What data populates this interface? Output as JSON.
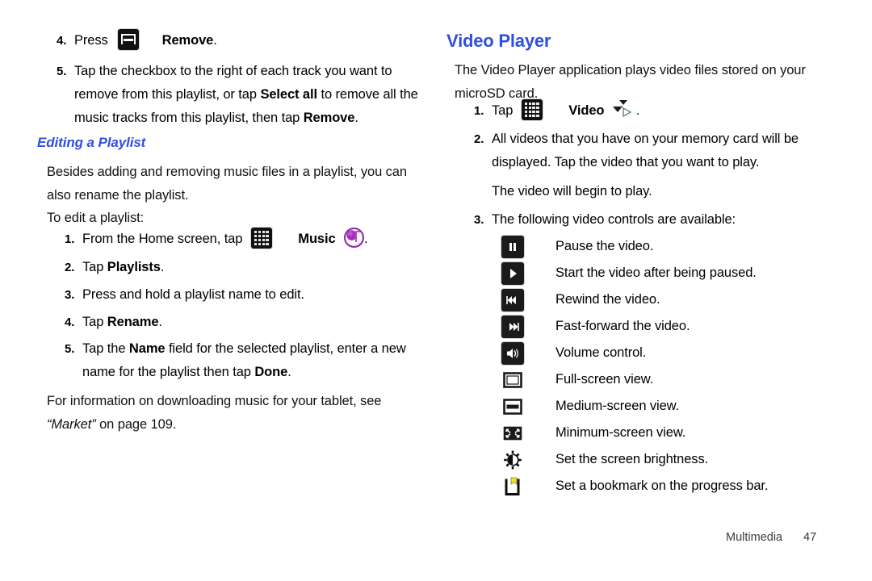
{
  "document": {
    "footer": {
      "section": "Multimedia",
      "page_number": "47"
    },
    "heading_color": "#2f4fe0",
    "body_color": "#111111"
  },
  "left_column": {
    "steps_continued": [
      {
        "num": "4.",
        "pre": "Press",
        "icon": "menu-key-icon",
        "bold_after": "Remove",
        "post": "."
      }
    ],
    "step5": {
      "num": "5.",
      "line1_a": "Tap the checkbox to the right of each track you want to",
      "line2_a": "remove from this playlist, or tap ",
      "line2_b": "Select all",
      "line2_c": " to remove all the",
      "line3_a": "music tracks from this playlist, then tap ",
      "line3_b": "Remove",
      "line3_c": "."
    },
    "section_heading": "Editing a Playlist",
    "intro_line1": "Besides adding and removing music files in a playlist, you can",
    "intro_line2": "also rename the playlist.",
    "lead_in": "To edit a playlist:",
    "steps": [
      {
        "num": "1.",
        "pre": "From the Home screen, tap",
        "icon": "app-grid-icon",
        "bold": "Music",
        "trailing_icon": "music-app-icon",
        "post": "."
      },
      {
        "num": "2.",
        "pre": "Tap ",
        "bold": "Playlists",
        "post": "."
      },
      {
        "num": "3.",
        "pre": "Press and hold a playlist name to edit.",
        "bold": "",
        "post": ""
      },
      {
        "num": "4.",
        "pre": "Tap ",
        "bold": "Rename",
        "post": "."
      }
    ],
    "step5b": {
      "num": "5.",
      "line1_a": "Tap the ",
      "line1_b": "Name",
      "line1_c": " field for the selected playlist, enter a new",
      "line2_a": "name for the playlist then tap ",
      "line2_b": "Done",
      "line2_c": "."
    },
    "closing_line1": "For information on downloading music for your tablet, see",
    "closing_italic": "“Market”",
    "closing_line2_rest": " on page 109."
  },
  "right_column": {
    "heading": "Video Player",
    "intro_line1": "The Video Player application plays video files stored on your",
    "intro_line2": "microSD card.",
    "step1": {
      "num": "1.",
      "pre": "Tap",
      "icon": "app-grid-icon",
      "bold": "Video",
      "trailing_icon": "video-app-icon",
      "post": "."
    },
    "step2": {
      "num": "2.",
      "line1": "All videos that you have on your memory card will be",
      "line2": "displayed. Tap the video that you want to play.",
      "line3": "The video will begin to play."
    },
    "step3": {
      "num": "3.",
      "text": "The following video controls are available:"
    },
    "controls": [
      {
        "icon": "pause-icon",
        "label": "Pause the video."
      },
      {
        "icon": "play-icon",
        "label": "Start the video after being paused."
      },
      {
        "icon": "rewind-icon",
        "label": "Rewind the video."
      },
      {
        "icon": "fast-forward-icon",
        "label": "Fast-forward the video."
      },
      {
        "icon": "volume-icon",
        "label": "Volume control."
      },
      {
        "icon": "full-screen-icon",
        "label": "Full-screen view."
      },
      {
        "icon": "medium-screen-icon",
        "label": "Medium-screen view."
      },
      {
        "icon": "minimum-screen-icon",
        "label": "Minimum-screen view."
      },
      {
        "icon": "brightness-icon",
        "label": "Set the screen brightness."
      },
      {
        "icon": "bookmark-icon",
        "label": "Set a bookmark on the progress bar."
      }
    ]
  }
}
